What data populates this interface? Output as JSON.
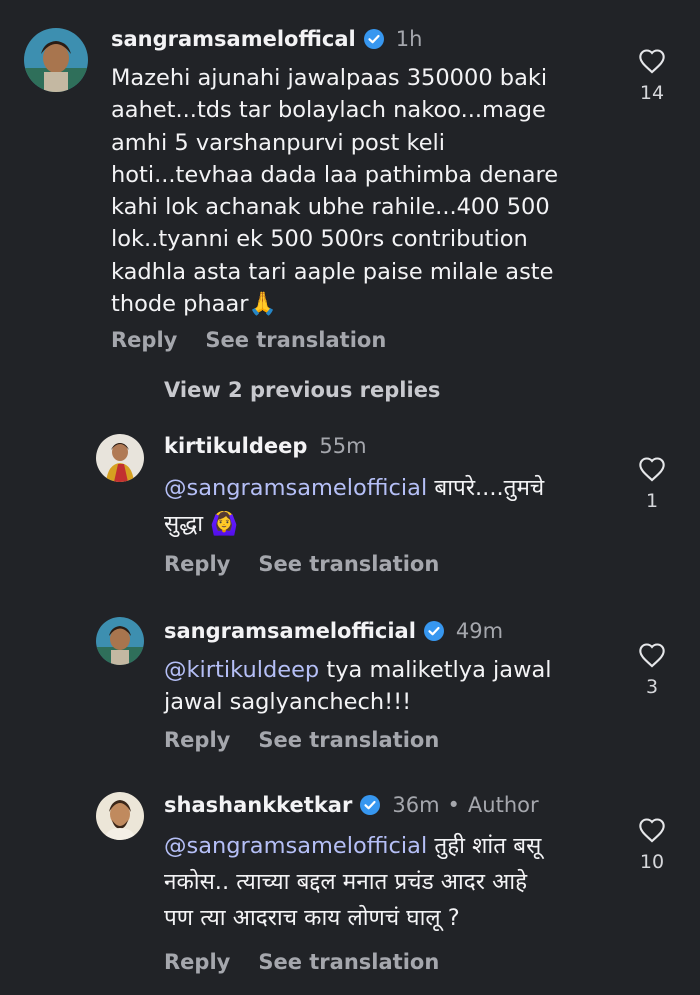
{
  "comments": [
    {
      "username": "sangramsameloffical",
      "verified": true,
      "time": "1h",
      "lines": [
        "Mazehi ajunahi jawalpaas 350000 baki",
        "aahet...tds tar bolaylach nakoo...mage",
        "amhi 5 varshanpurvi post keli",
        "hoti...tevhaa dada laa pathimba denare",
        "kahi lok achanak ubhe rahile...400 500",
        "lok..tyanni ek 500 500rs contribution",
        "kadhla asta tari aaple paise milale aste",
        "thode phaar🙏"
      ],
      "reply_label": "Reply",
      "translate_label": "See translation",
      "likes": "14"
    },
    {
      "username": "kirtikuldeep",
      "verified": false,
      "time": "55m",
      "mention": "@sangramsamelofficial",
      "line1_rest": " बापरे....तुमचे",
      "line2": "सुद्धा 🙆‍♀️",
      "reply_label": "Reply",
      "translate_label": "See translation",
      "likes": "1"
    },
    {
      "username": "sangramsamelofficial",
      "verified": true,
      "time": "49m",
      "mention": "@kirtikuldeep",
      "line1_rest": " tya maliketlya jawal",
      "line2": "jawal saglyanchech!!!",
      "reply_label": "Reply",
      "translate_label": "See translation",
      "likes": "3"
    },
    {
      "username": "shashankketkar",
      "verified": true,
      "time": "36m",
      "separator": "•",
      "author": "Author",
      "mention": "@sangramsamelofficial",
      "line1_rest": " तुही शांत बसू",
      "line2": "नकोस.. त्याच्या बद्दल मनात प्रचंड आदर आहे",
      "line3": "पण त्या आदराच काय लोणचं घालू ?",
      "reply_label": "Reply",
      "translate_label": "See translation",
      "likes": "10"
    }
  ],
  "view_previous": "View 2 previous replies",
  "colors": {
    "background": "#212327",
    "mention": "#b5bff6",
    "verified": "#3797f0",
    "muted": "#a5a7ad"
  },
  "icons": {
    "like": "heart-outline-icon",
    "verified": "verified-badge-icon"
  }
}
